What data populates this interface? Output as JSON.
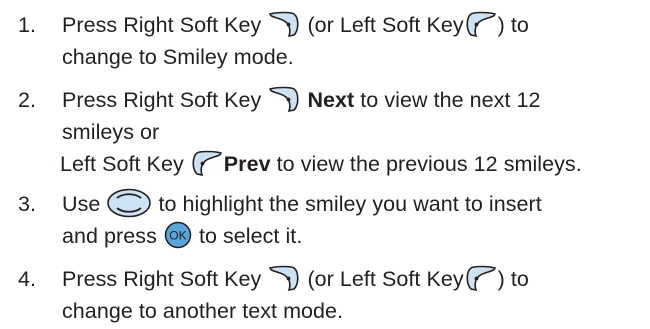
{
  "steps": [
    {
      "number": "1.",
      "lines": [
        {
          "a": "Press Right Soft Key",
          "icon1": "right-soft-key-icon",
          "b": "(or Left Soft Key",
          "icon2": "left-soft-key-icon",
          "c": ") to"
        },
        {
          "text": "change to Smiley mode."
        }
      ]
    },
    {
      "number": "2.",
      "lines": [
        {
          "a": "Press Right Soft Key",
          "icon1": "right-soft-key-icon",
          "bold": "Next",
          "c": "to view the next 12"
        },
        {
          "text": "smileys or"
        },
        {
          "a": "Left Soft Key",
          "icon1": "left-soft-key-icon",
          "bold": "Prev",
          "c": "to view the previous 12  smileys."
        }
      ]
    },
    {
      "number": "3.",
      "lines": [
        {
          "a": "Use",
          "icon1": "navigation-key-icon",
          "c": "to highlight the smiley you want to insert"
        },
        {
          "a": "and press",
          "icon1": "ok-key-icon",
          "c": "to select it."
        }
      ]
    },
    {
      "number": "4.",
      "lines": [
        {
          "a": "Press Right Soft Key",
          "icon1": "right-soft-key-icon",
          "b": "(or Left Soft Key",
          "icon2": "left-soft-key-icon",
          "c": ") to"
        },
        {
          "text": "change to another text mode."
        }
      ]
    }
  ],
  "colors": {
    "text": "#231f20",
    "key_fill": "#cde3f3",
    "key_stroke": "#231f20",
    "ok_fill": "#5aa5da"
  }
}
